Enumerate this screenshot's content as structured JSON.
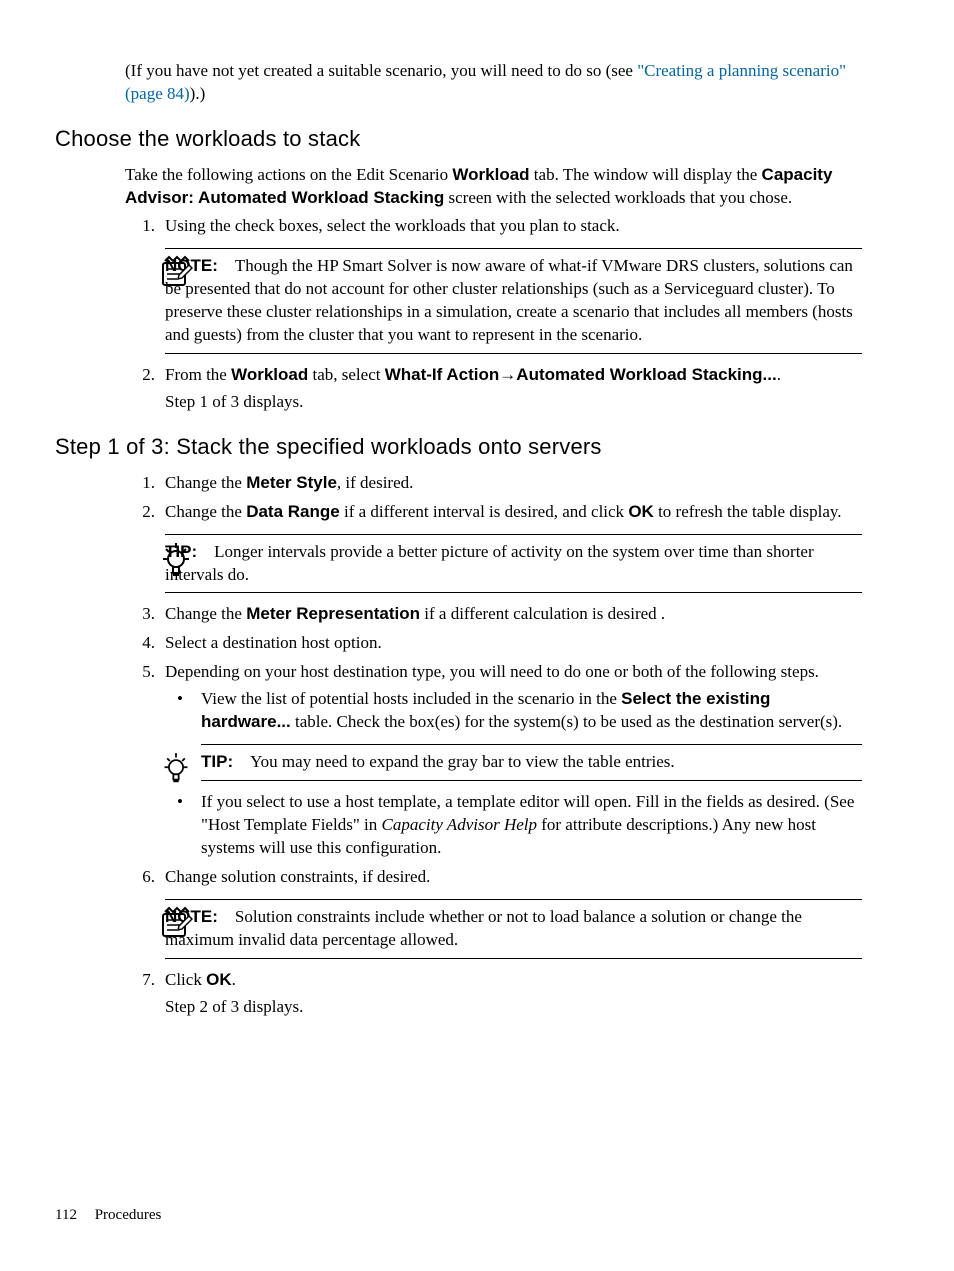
{
  "intro": {
    "line1_pre": "(If you have not yet created a suitable scenario, you will need to do so (see ",
    "link_text": "\"Creating a planning scenario\" (page 84)",
    "line1_post": ").)"
  },
  "section1": {
    "heading": "Choose the workloads to stack",
    "para_pre": "Take the following actions on the Edit Scenario ",
    "para_bold1": "Workload",
    "para_mid": " tab. The window will display the ",
    "para_bold2": "Capacity Advisor: Automated Workload Stacking",
    "para_post": " screen with the selected workloads that you chose.",
    "step1_num": "1.",
    "step1": "Using the check boxes, select the workloads that you plan to stack.",
    "note_label": "NOTE:",
    "note_text": "Though the HP Smart Solver is now aware of what-if VMware DRS clusters, solutions can be presented that do not account for other cluster relationships (such as a Serviceguard cluster). To preserve these cluster relationships in a simulation, create a scenario that includes all members (hosts and guests) from the cluster that you want to represent in the scenario.",
    "step2_num": "2.",
    "step2_pre": "From the ",
    "step2_b1": "Workload",
    "step2_mid1": " tab, select ",
    "step2_b2": "What-If Action",
    "step2_arrow": "→",
    "step2_b3": "Automated Workload Stacking...",
    "step2_post": ".",
    "step2_line2": "Step 1 of 3 displays."
  },
  "section2": {
    "heading": "Step 1 of 3: Stack the specified workloads onto servers",
    "s1_num": "1.",
    "s1_pre": "Change the ",
    "s1_b": "Meter Style",
    "s1_post": ", if desired.",
    "s2_num": "2.",
    "s2_pre": "Change the ",
    "s2_b1": "Data Range",
    "s2_mid": " if a different interval is desired, and click ",
    "s2_b2": "OK",
    "s2_post": " to refresh the table display.",
    "tip1_label": "TIP:",
    "tip1_text": "Longer intervals provide a better picture of activity on the system over time than shorter intervals do.",
    "s3_num": "3.",
    "s3_pre": "Change the ",
    "s3_b": "Meter Representation",
    "s3_post": " if a different calculation is desired .",
    "s4_num": "4.",
    "s4_text": "Select a destination host option.",
    "s5_num": "5.",
    "s5_text": "Depending on your host destination type, you will need to do one or both of the following steps.",
    "s5_b1_pre": "View the list of potential hosts included in the scenario in the ",
    "s5_b1_b": "Select the existing hardware...",
    "s5_b1_post": " table. Check the box(es) for the system(s) to be used as the destination server(s).",
    "tip2_label": "TIP:",
    "tip2_text": "You may need to expand the gray bar to view the table entries.",
    "s5_b2_pre": "If you select to use a host template, a template editor will open. Fill in the fields as desired. (See \"Host Template Fields\" in ",
    "s5_b2_italic": "Capacity Advisor Help",
    "s5_b2_post": " for attribute descriptions.) Any new host systems will use this configuration.",
    "s6_num": "6.",
    "s6_text": "Change solution constraints, if desired.",
    "note2_label": "NOTE:",
    "note2_text": "Solution constraints include whether or not to load balance a solution or change the maximum invalid data percentage allowed.",
    "s7_num": "7.",
    "s7_pre": "Click ",
    "s7_b": "OK",
    "s7_post": ".",
    "s7_line2": "Step 2 of 3 displays."
  },
  "footer": {
    "page": "112",
    "section": "Procedures"
  }
}
